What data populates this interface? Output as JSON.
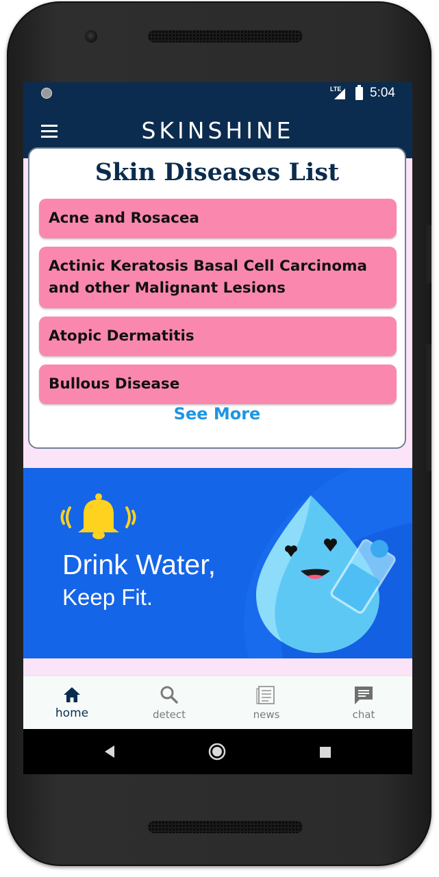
{
  "status_bar": {
    "network": "LTE",
    "time": "5:04"
  },
  "app_bar": {
    "title": "SKINSHINE",
    "menu_icon": "hamburger-menu-icon"
  },
  "diseases_card": {
    "title": "Skin Diseases List",
    "items": [
      {
        "label": "Acne and Rosacea"
      },
      {
        "label": "Actinic Keratosis Basal Cell Carcinoma and other Malignant Lesions"
      },
      {
        "label": "Atopic Dermatitis"
      },
      {
        "label": "Bullous Disease"
      }
    ],
    "see_more_label": "See More"
  },
  "banner": {
    "title": "Drink Water,",
    "subtitle": "Keep Fit."
  },
  "bottom_nav": {
    "items": [
      {
        "label": "home",
        "icon": "home-icon",
        "active": true
      },
      {
        "label": "detect",
        "icon": "search-icon",
        "active": false
      },
      {
        "label": "news",
        "icon": "news-icon",
        "active": false
      },
      {
        "label": "chat",
        "icon": "chat-icon",
        "active": false
      }
    ]
  },
  "colors": {
    "app_bar": "#0b2c4e",
    "page_background": "#fbe4f7",
    "disease_item": "#fa88ae",
    "see_more": "#1f95e2",
    "banner": "#1565e8",
    "nav_active": "#0b2c4e",
    "nav_inactive": "#7a7a7a"
  }
}
